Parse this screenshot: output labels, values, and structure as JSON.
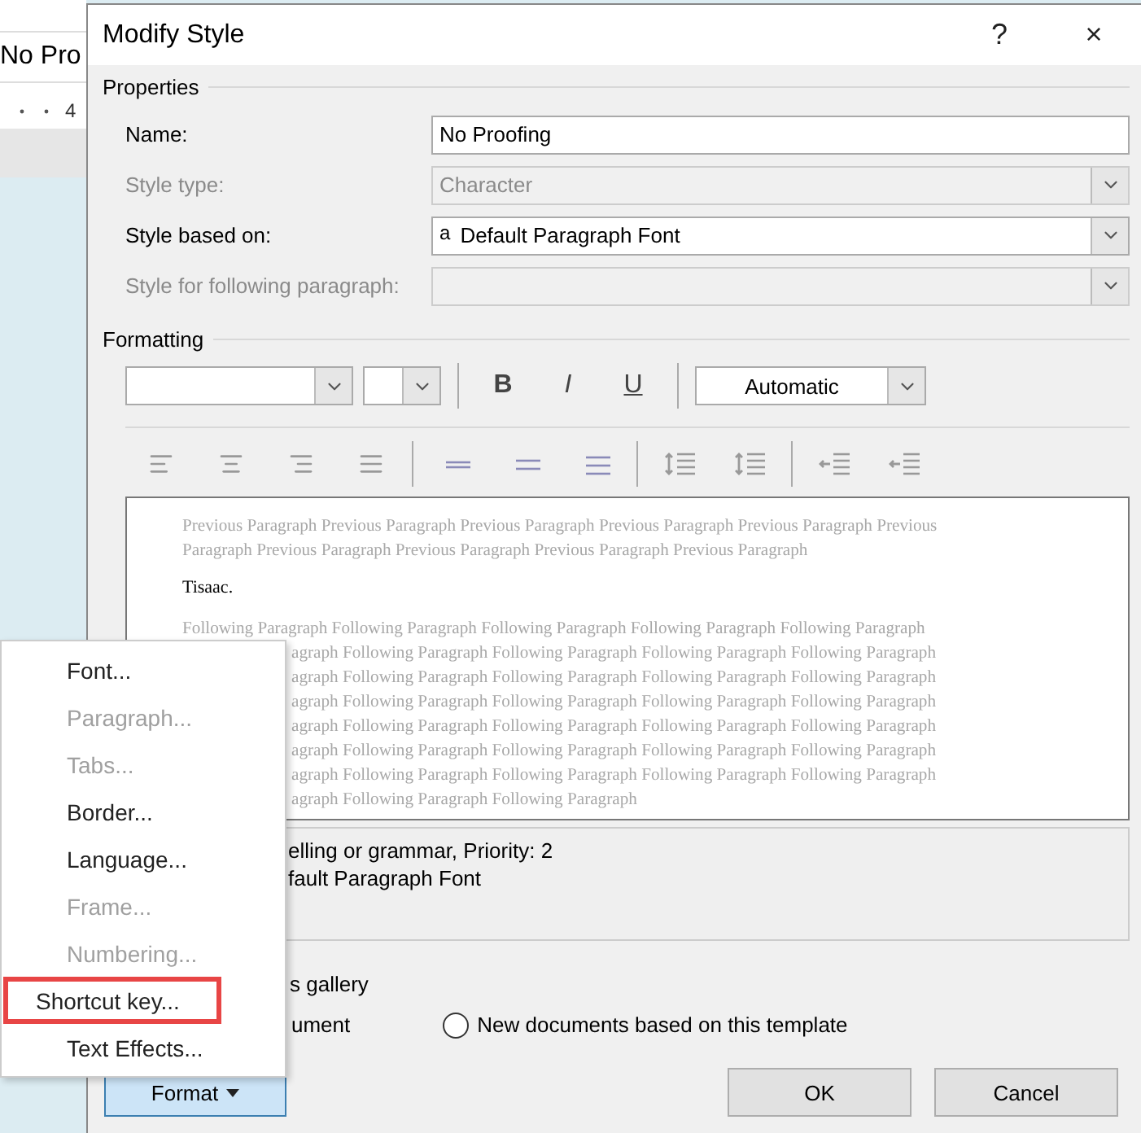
{
  "background_app": {
    "style_box": "No Pro",
    "ruler_mark": "4"
  },
  "window": {
    "title": "Modify Style",
    "help": "?",
    "close": "×"
  },
  "properties": {
    "heading": "Properties",
    "rows": [
      {
        "label": "Name:",
        "kind": "text",
        "value": "No Proofing",
        "disabled": false
      },
      {
        "label": "Style type:",
        "kind": "combo",
        "value": "Character",
        "disabled": true
      },
      {
        "label": "Style based on:",
        "kind": "combo",
        "value": "Default Paragraph Font",
        "marker": "a",
        "disabled": false
      },
      {
        "label": "Style for following paragraph:",
        "kind": "combo",
        "disabled": true
      }
    ]
  },
  "formatting": {
    "heading": "Formatting",
    "bold": "B",
    "italic": "I",
    "underline": "U",
    "color_label": "Automatic"
  },
  "preview": {
    "previous": [
      "Previous Paragraph Previous Paragraph Previous Paragraph Previous Paragraph Previous Paragraph Previous",
      "Paragraph Previous Paragraph Previous Paragraph Previous Paragraph Previous Paragraph"
    ],
    "sample": "Tisaac.",
    "following": [
      "Following Paragraph Following Paragraph Following Paragraph Following Paragraph Following Paragraph",
      "agraph Following Paragraph Following Paragraph Following Paragraph Following Paragraph",
      "agraph Following Paragraph Following Paragraph Following Paragraph Following Paragraph",
      "agraph Following Paragraph Following Paragraph Following Paragraph Following Paragraph",
      "agraph Following Paragraph Following Paragraph Following Paragraph Following Paragraph",
      "agraph Following Paragraph Following Paragraph Following Paragraph Following Paragraph",
      "agraph Following Paragraph Following Paragraph Following Paragraph Following Paragraph",
      "agraph Following Paragraph Following Paragraph"
    ]
  },
  "description": [
    "elling or grammar, Priority: 2",
    "fault Paragraph Font"
  ],
  "gallery_option": "s gallery",
  "scope_options": [
    {
      "label": "ument",
      "kind": "text"
    },
    {
      "label": "New documents based on this template",
      "kind": "radio",
      "selected": false
    }
  ],
  "format_button": "Format",
  "buttons": [
    "OK",
    "Cancel"
  ],
  "format_menu": [
    {
      "label": "Font...",
      "disabled": false,
      "highlighted": false
    },
    {
      "label": "Paragraph...",
      "disabled": true,
      "highlighted": false
    },
    {
      "label": "Tabs...",
      "disabled": true,
      "highlighted": false
    },
    {
      "label": "Border...",
      "disabled": false,
      "highlighted": false
    },
    {
      "label": "Language...",
      "disabled": false,
      "highlighted": false
    },
    {
      "label": "Frame...",
      "disabled": true,
      "highlighted": false
    },
    {
      "label": "Numbering...",
      "disabled": true,
      "highlighted": false
    },
    {
      "label": "Shortcut key...",
      "disabled": false,
      "highlighted": true
    },
    {
      "label": "Text Effects...",
      "disabled": false,
      "highlighted": false
    }
  ]
}
